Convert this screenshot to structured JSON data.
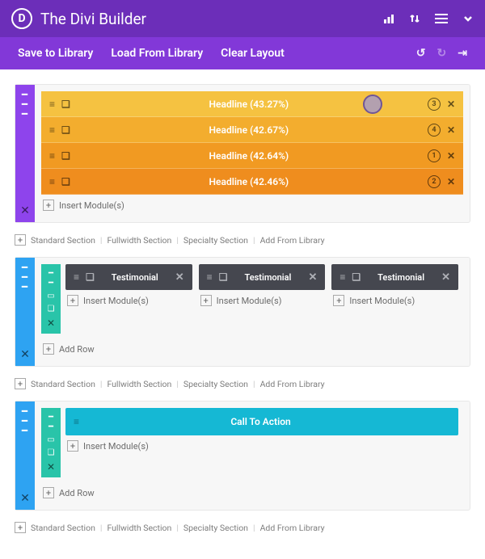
{
  "header": {
    "logo_letter": "D",
    "title": "The Divi Builder"
  },
  "subheader": {
    "save": "Save to Library",
    "load": "Load From Library",
    "clear": "Clear Layout"
  },
  "sections": [
    {
      "type": "split",
      "modules": [
        {
          "label": "Headline (43.27%)",
          "badge": "3",
          "cursor": true
        },
        {
          "label": "Headline (42.67%)",
          "badge": "4"
        },
        {
          "label": "Headline (42.64%)",
          "badge": "1"
        },
        {
          "label": "Headline (42.46%)",
          "badge": "2"
        }
      ],
      "insert": "Insert Module(s)"
    }
  ],
  "testimonials": {
    "item_label": "Testimonial",
    "insert": "Insert Module(s)",
    "add_row": "Add Row"
  },
  "cta": {
    "label": "Call To Action",
    "insert": "Insert Module(s)",
    "add_row": "Add Row"
  },
  "footer": {
    "standard": "Standard Section",
    "fullwidth": "Fullwidth Section",
    "specialty": "Specialty Section",
    "addlib": "Add From Library"
  }
}
